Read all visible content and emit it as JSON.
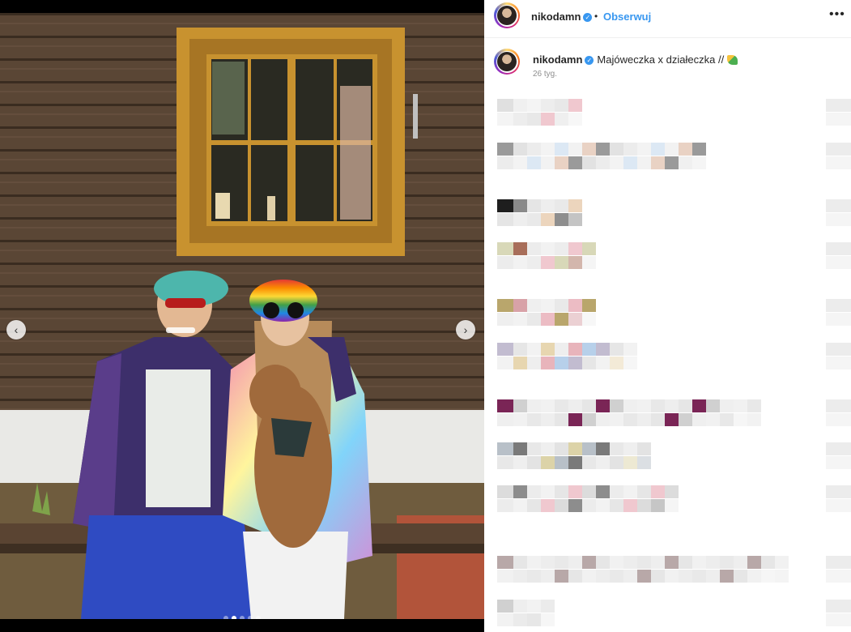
{
  "post": {
    "username": "nikodamn",
    "follow_label": "Obserwuj",
    "separator": "•",
    "more_label": "•••",
    "caption": "Majóweczka x działeczka //",
    "time_ago": "26 tyg.",
    "verified_mark": "✓"
  },
  "carousel": {
    "prev_label": "‹",
    "next_label": "›",
    "slide_count": 5,
    "active_index": 1
  },
  "colors": {
    "link_blue": "#3897f0",
    "text": "#262626",
    "muted": "#8e8e8e",
    "divider": "#efefef"
  },
  "icons": {
    "verified": "verified-badge-icon",
    "more": "more-options-icon",
    "prev": "chevron-left-icon",
    "next": "chevron-right-icon",
    "caption_emoji": "leaf-emoji-icon"
  }
}
